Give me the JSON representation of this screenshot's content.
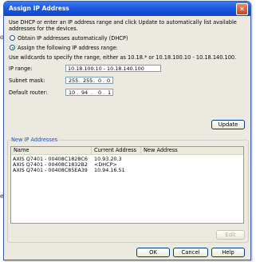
{
  "background": {
    "fragment_top": "o",
    "fragment_bottom": "e"
  },
  "dialog": {
    "title": "Assign IP Address",
    "description": "Use DHCP or enter an IP address range and click Update to automatically list available addresses for the devices.",
    "option_dhcp": "Obtain IP addresses automatically (DHCP)",
    "option_manual": "Assign the following IP address range:",
    "hint": "Use wildcards to specify the range, either as 10.18.* or 10.18.100.10 - 10.18.140.100.",
    "ip_range_label": "IP range:",
    "ip_range_value": "10.18.100.10 - 10.18.140.100",
    "subnet_label": "Subnet mask:",
    "subnet_octets": [
      "255",
      "255",
      "0",
      "0"
    ],
    "router_label": "Default router:",
    "router_octets": [
      "10",
      "94",
      "0",
      "1"
    ],
    "update_button": "Update",
    "new_ip_group": "New IP Addresses",
    "columns": [
      "Name",
      "Current Address",
      "New Address"
    ],
    "rows": [
      {
        "name": "AXIS Q7401 - 00408C1828C6",
        "current": "10.93.20.3",
        "new": ""
      },
      {
        "name": "AXIS Q7401 - 00408C1832B2",
        "current": "<DHCP>",
        "new": ""
      },
      {
        "name": "AXIS Q7401 - 00408C85EA39",
        "current": "10.94.16.51",
        "new": ""
      }
    ],
    "edit_button": "Edit",
    "ok_button": "OK",
    "cancel_button": "Cancel",
    "help_button": "Help"
  }
}
